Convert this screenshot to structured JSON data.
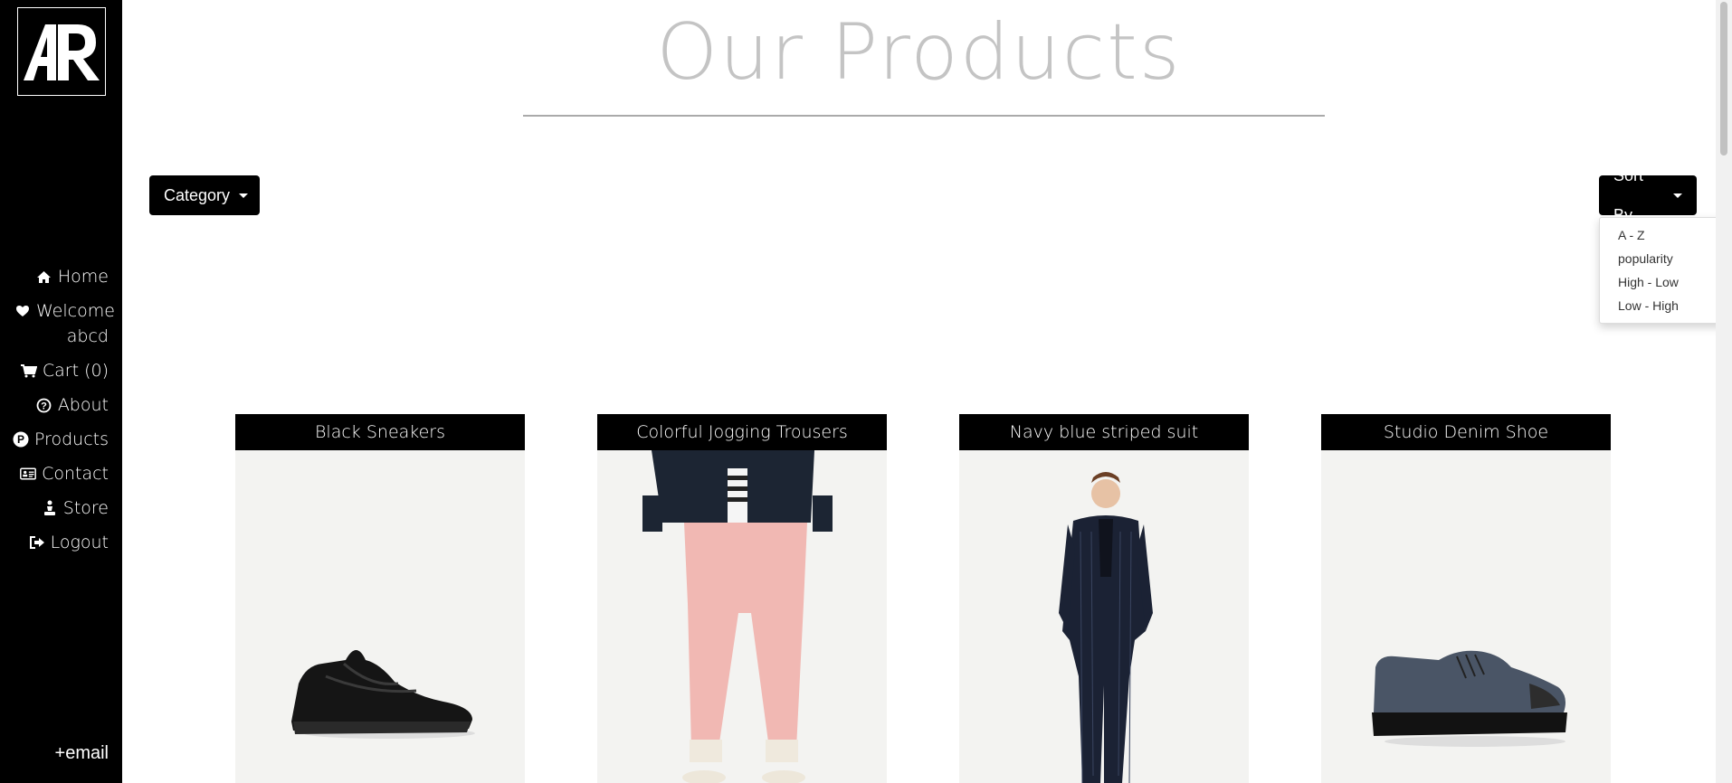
{
  "sidebar": {
    "logo": {
      "text": "AR"
    },
    "nav": [
      {
        "label": "Home",
        "icon": "home-icon"
      },
      {
        "label": "Welcome abcd",
        "icon": "heart-icon"
      },
      {
        "label": "Cart (0)",
        "icon": "cart-icon"
      },
      {
        "label": "About",
        "icon": "question-icon"
      },
      {
        "label": "Products",
        "icon": "product-badge-icon"
      },
      {
        "label": "Contact",
        "icon": "contact-card-icon"
      },
      {
        "label": "Store",
        "icon": "store-figure-icon"
      },
      {
        "label": "Logout",
        "icon": "logout-icon"
      }
    ],
    "email_link": "+email"
  },
  "main": {
    "title": "Our Products",
    "category_button": "Category",
    "sort_button": "Sort By",
    "sort_options": [
      "A - Z",
      "popularity",
      "High - Low",
      "Low - High"
    ]
  },
  "products": [
    {
      "name": "Black Sneakers"
    },
    {
      "name": "Colorful Jogging Trousers"
    },
    {
      "name": "Navy blue striped suit"
    },
    {
      "name": "Studio Denim Shoe"
    }
  ],
  "colors": {
    "sidebar": "#000000",
    "title": "#c4c4c4",
    "button": "#000000"
  }
}
